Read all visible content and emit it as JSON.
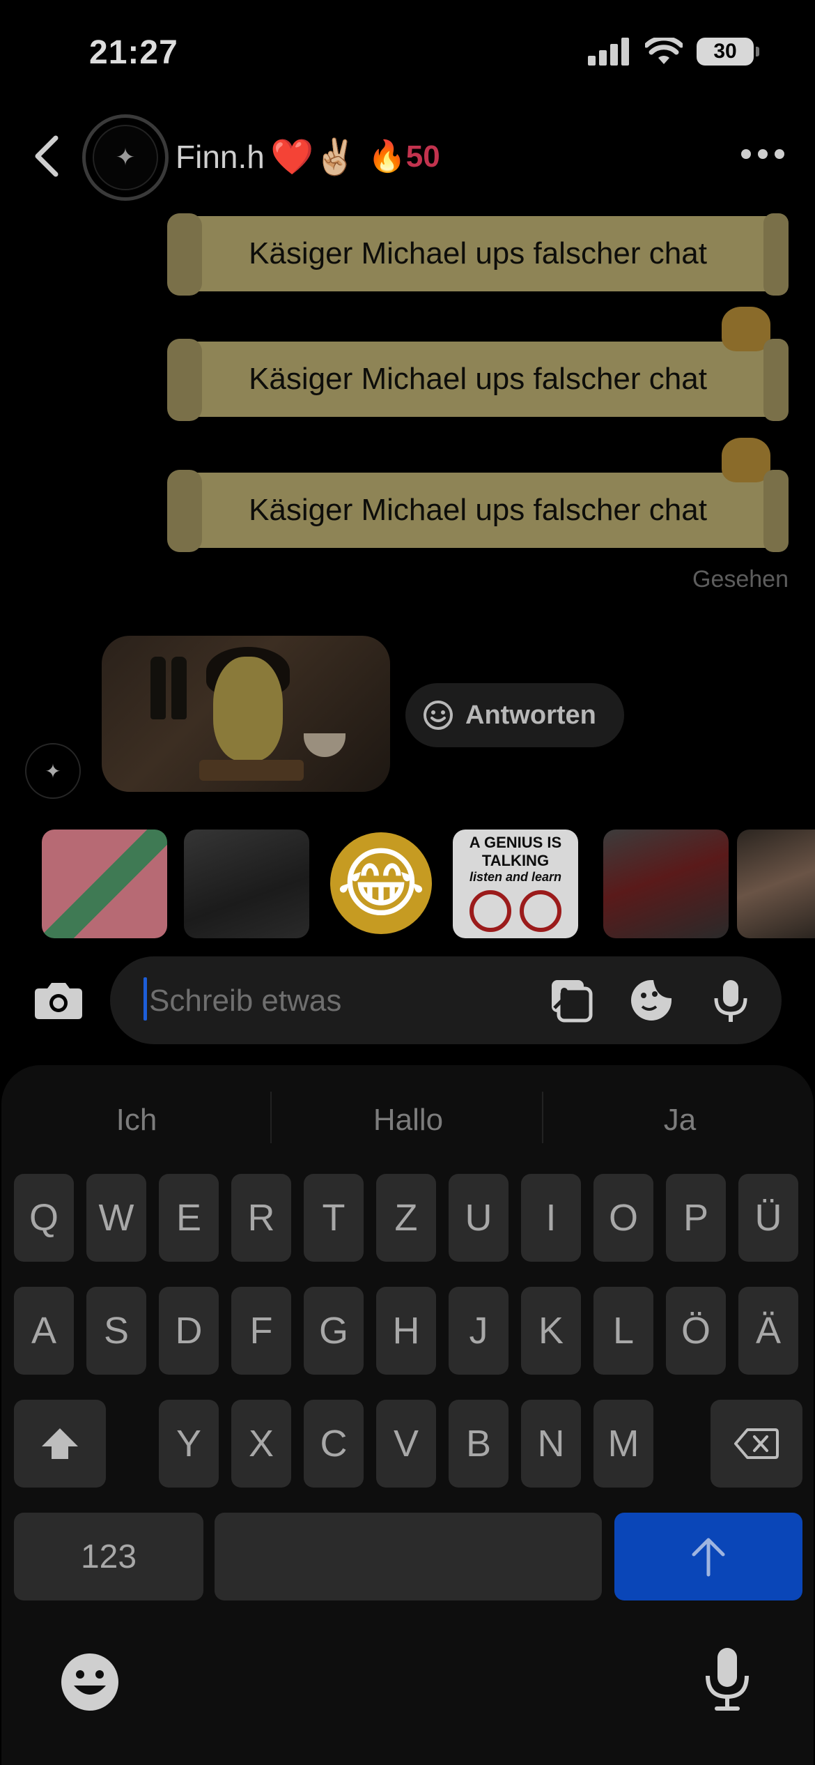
{
  "status_bar": {
    "time": "21:27",
    "battery": "30"
  },
  "header": {
    "name": "Finn.h",
    "decor_emojis": "❤️✌🏼",
    "streak": "🔥50"
  },
  "messages": {
    "sent": [
      "Käsiger Michael ups falscher chat",
      "Käsiger Michael ups falscher chat",
      "Käsiger Michael ups falscher chat"
    ],
    "seen_label": "Gesehen",
    "reply_label": "Antworten"
  },
  "stickers": {
    "emoji": "😂",
    "genius_title": "A GENIUS IS TALKING",
    "genius_sub": "listen and learn"
  },
  "composer": {
    "placeholder": "Schreib etwas"
  },
  "keyboard": {
    "suggestions": [
      "Ich",
      "Hallo",
      "Ja"
    ],
    "row1": [
      "Q",
      "W",
      "E",
      "R",
      "T",
      "Z",
      "U",
      "I",
      "O",
      "P",
      "Ü"
    ],
    "row2": [
      "A",
      "S",
      "D",
      "F",
      "G",
      "H",
      "J",
      "K",
      "L",
      "Ö",
      "Ä"
    ],
    "row3": [
      "Y",
      "X",
      "C",
      "V",
      "B",
      "N",
      "M"
    ],
    "numbers_key": "123"
  }
}
